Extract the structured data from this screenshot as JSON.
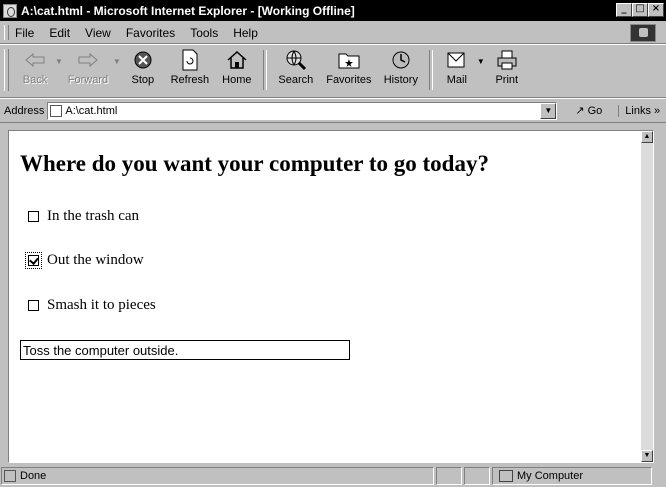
{
  "window": {
    "title": "A:\\cat.html - Microsoft Internet Explorer - [Working Offline]"
  },
  "menu": [
    "File",
    "Edit",
    "View",
    "Favorites",
    "Tools",
    "Help"
  ],
  "toolbar": {
    "back": "Back",
    "forward": "Forward",
    "stop": "Stop",
    "refresh": "Refresh",
    "home": "Home",
    "search": "Search",
    "favorites": "Favorites",
    "history": "History",
    "mail": "Mail",
    "print": "Print"
  },
  "address": {
    "label": "Address",
    "value": "A:\\cat.html",
    "go": "Go",
    "links": "Links"
  },
  "page": {
    "heading": "Where do you want your computer to go today?",
    "options": [
      {
        "label": "In the trash can",
        "checked": false
      },
      {
        "label": "Out the window",
        "checked": true
      },
      {
        "label": "Smash it to pieces",
        "checked": false
      }
    ],
    "textbox_value": "Toss the computer outside."
  },
  "status": {
    "text": "Done",
    "zone": "My Computer"
  }
}
